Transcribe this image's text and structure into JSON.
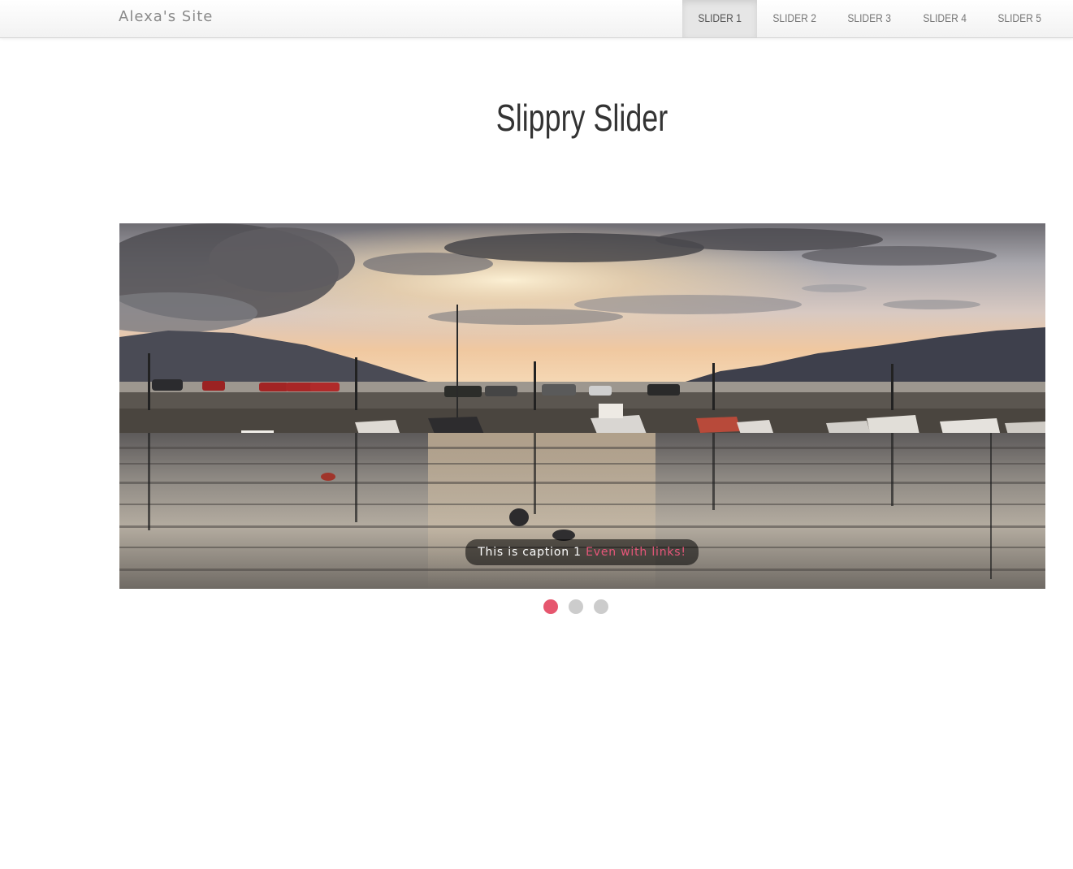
{
  "site": {
    "brand": "Alexa's Site"
  },
  "nav": {
    "items": [
      {
        "label": "Slider 1",
        "active": true
      },
      {
        "label": "Slider 2",
        "active": false
      },
      {
        "label": "Slider 3",
        "active": false
      },
      {
        "label": "Slider 4",
        "active": false
      },
      {
        "label": "Slider 5",
        "active": false
      }
    ]
  },
  "main": {
    "title": "Slippry Slider"
  },
  "slider": {
    "image_alt": "harbor-sunset-photo",
    "caption_text": "This is caption 1",
    "caption_link": "Even with links!",
    "slide_count": 3,
    "active_slide": 1
  },
  "colors": {
    "accent": "#e6566e",
    "link": "#e8567a",
    "dot_inactive": "#cccccc"
  }
}
